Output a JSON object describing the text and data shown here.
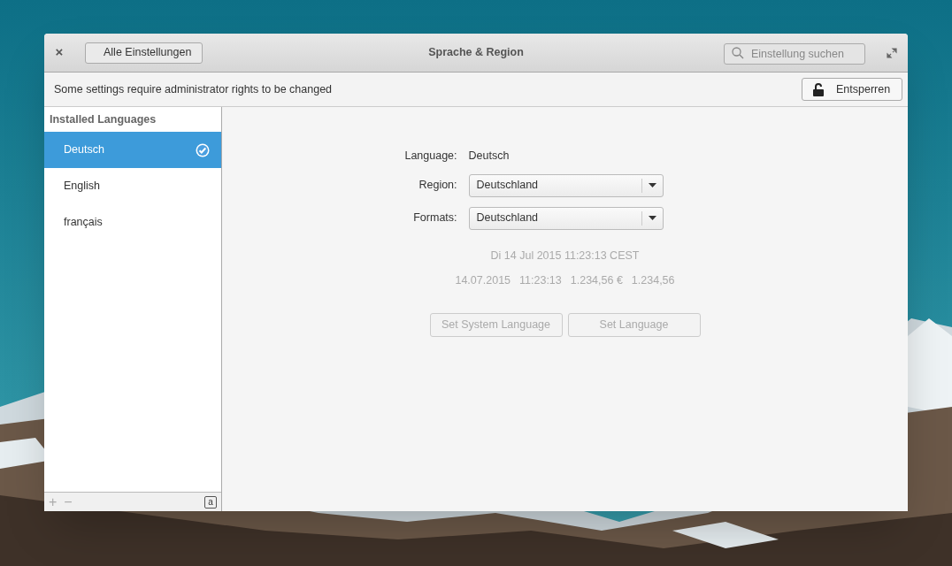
{
  "header": {
    "close": "×",
    "back": "Alle Einstellungen",
    "title": "Sprache & Region",
    "search": {
      "placeholder": "Einstellung suchen"
    }
  },
  "infobar": {
    "message": "Some settings require administrator rights to be changed",
    "unlock": "Entsperren"
  },
  "sidebar": {
    "heading": "Installed Languages",
    "items": [
      {
        "label": "Deutsch",
        "selected": true,
        "checked": true
      },
      {
        "label": "English",
        "selected": false,
        "checked": false
      },
      {
        "label": "français",
        "selected": false,
        "checked": false
      }
    ],
    "footer": {
      "add": "+",
      "remove": "−",
      "keyboard": "a"
    }
  },
  "form": {
    "language_label": "Language:",
    "language": "Deutsch",
    "region_label": "Region:",
    "region": "Deutschland",
    "formats_label": "Formats:",
    "formats": "Deutschland"
  },
  "preview": {
    "long_date": "Di 14 Jul 2015 11:23:13 CEST",
    "values": [
      "14.07.2015",
      "11:23:13",
      "1.234,56 €",
      "1.234,56"
    ]
  },
  "buttons": [
    {
      "label": "Set System Language",
      "disabled": true
    },
    {
      "label": "Set Language",
      "disabled": true
    }
  ]
}
